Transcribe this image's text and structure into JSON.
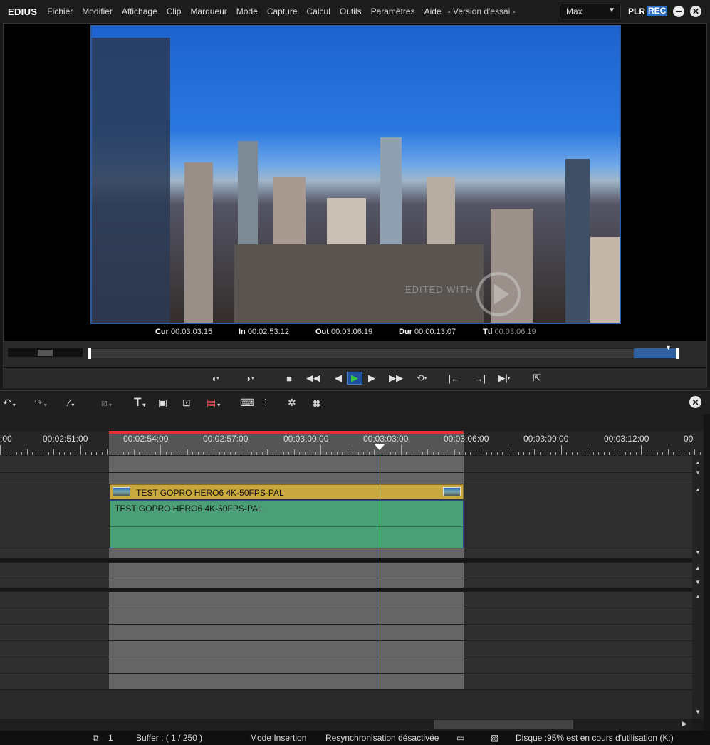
{
  "app": {
    "logo": "EDIUS",
    "trial_text": "- Version d'essai -",
    "preset": "Max",
    "plr": "PLR",
    "rec": "REC"
  },
  "menu": [
    {
      "label": "Fichier"
    },
    {
      "label": "Modifier"
    },
    {
      "label": "Affichage"
    },
    {
      "label": "Clip"
    },
    {
      "label": "Marqueur"
    },
    {
      "label": "Mode"
    },
    {
      "label": "Capture"
    },
    {
      "label": "Calcul"
    },
    {
      "label": "Outils"
    },
    {
      "label": "Paramètres"
    },
    {
      "label": "Aide"
    }
  ],
  "player": {
    "watermark": "EDITED WITH",
    "timecodes": {
      "cur_label": "Cur",
      "cur": "00:03:03:15",
      "in_label": "In",
      "in": "00:02:53:12",
      "out_label": "Out",
      "out": "00:03:06:19",
      "dur_label": "Dur",
      "dur": "00:00:13:07",
      "ttl_label": "Ttl",
      "ttl": "00:03:06:19"
    }
  },
  "timeline": {
    "ruler_labels": [
      "00:02:51:00",
      "00:02:54:00",
      "00:02:57:00",
      "00:03:00:00",
      "00:03:03:00",
      "00:03:06:00",
      "00:03:09:00",
      "00:03:12:00"
    ],
    "ruler_left_partial": ":00",
    "ruler_right_partial": "00",
    "clip_video_name": "TEST GOPRO HERO6 4K-50FPS-PAL",
    "clip_audio_name": "TEST GOPRO HERO6 4K-50FPS-PAL"
  },
  "status": {
    "track_count": "1",
    "buffer": "Buffer : (   1 / 250 )",
    "mode": "Mode Insertion",
    "resync": "Resynchronisation désactivée",
    "disk": "Disque :95% est en cours d'utilisation (K:)"
  },
  "colors": {
    "accent": "#2b6cc4",
    "clip_video": "#c9a83f",
    "clip_audio": "#4a9f76",
    "playhead": "#4cd8ff",
    "range_red": "#dd3333"
  },
  "icons": [
    "undo-icon",
    "redo-icon",
    "mark-in-tool-icon",
    "crop-icon",
    "title-icon",
    "camera-icon",
    "voiceover-icon",
    "export-icon",
    "keyboard-icon",
    "mixer-icon",
    "effects-icon",
    "tracks-icon"
  ]
}
